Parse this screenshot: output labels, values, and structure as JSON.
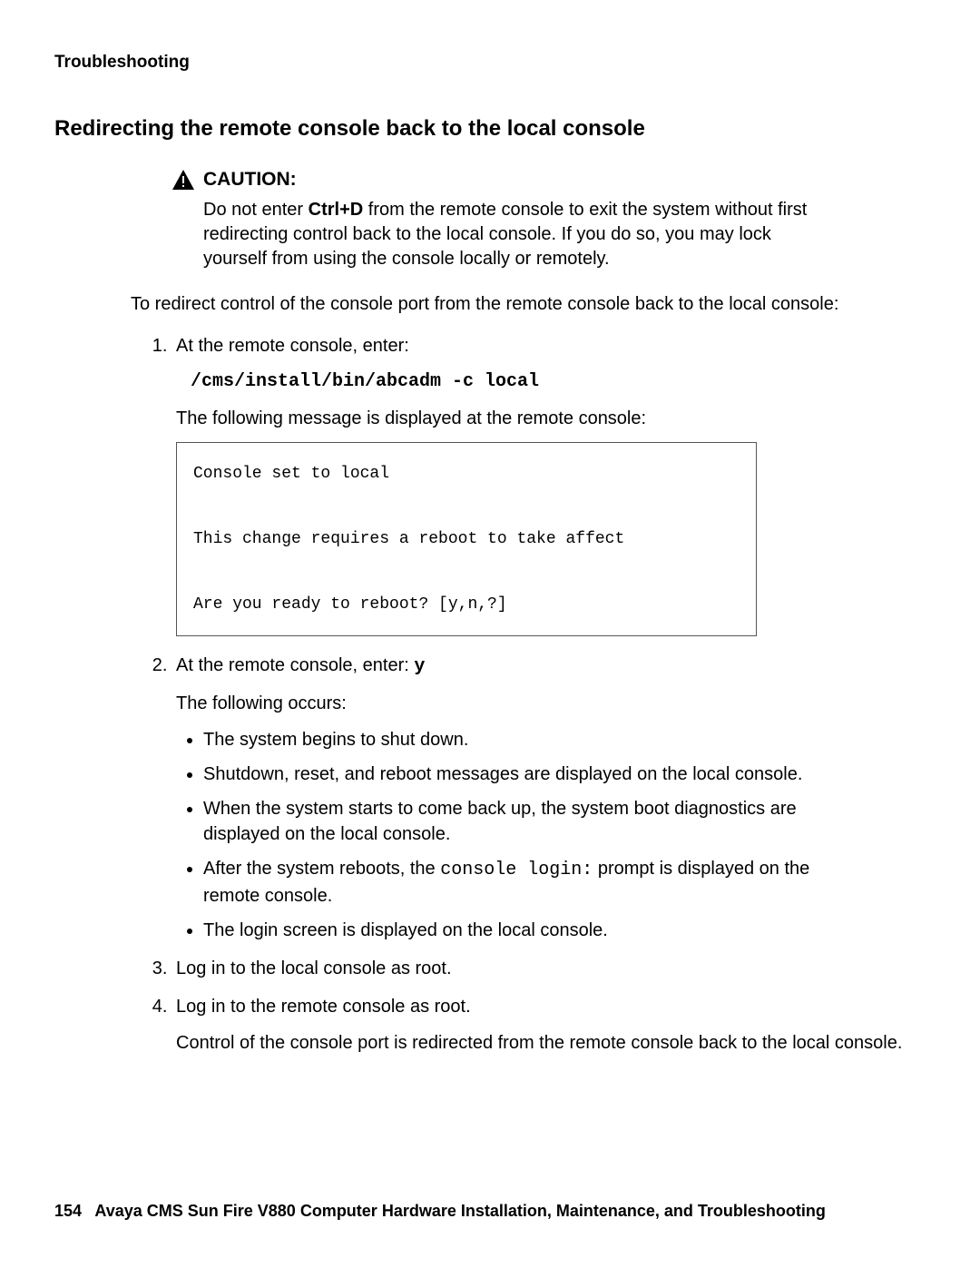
{
  "header": {
    "section": "Troubleshooting"
  },
  "title": "Redirecting the remote console back to the local console",
  "caution": {
    "label": "CAUTION:",
    "body_pre": "Do not enter ",
    "body_key": "Ctrl+D",
    "body_post": " from the remote console to exit the system without first redirecting control back to the local console. If you do so, you may lock yourself from using the console locally or remotely."
  },
  "intro": "To redirect control of the console port from the remote console back to the local console:",
  "step1": {
    "text": "At the remote console, enter:",
    "command": "/cms/install/bin/abcadm -c local",
    "followup": "The following message is displayed at the remote console:",
    "console": "Console set to local\n\nThis change requires a reboot to take affect\n\nAre you ready to reboot? [y,n,?]"
  },
  "step2": {
    "line_pre": "At the remote console, enter: ",
    "line_key": "y",
    "followup": "The following occurs:",
    "bullets": {
      "b1": "The system begins to shut down.",
      "b2": "Shutdown, reset, and reboot messages are displayed on the local console.",
      "b3": "When the system starts to come back up, the system boot diagnostics are displayed on the local console.",
      "b4_pre": "After the system reboots, the ",
      "b4_code": "console login:",
      "b4_post": " prompt is displayed on the remote console.",
      "b5": "The login screen is displayed on the local console."
    }
  },
  "step3": "Log in to the local console as root.",
  "step4": {
    "text": "Log in to the remote console as root.",
    "followup": "Control of the console port is redirected from the remote console back to the local console."
  },
  "footer": {
    "page": "154",
    "title": "Avaya CMS Sun Fire V880 Computer Hardware Installation, Maintenance, and Troubleshooting"
  }
}
